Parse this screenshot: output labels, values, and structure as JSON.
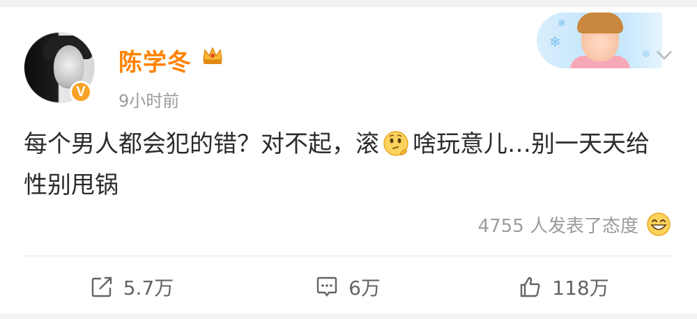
{
  "post": {
    "username": "陈学冬",
    "time": "9小时前",
    "text_before_emoji": "每个男人都会犯的错？对不起，滚",
    "text_after_emoji": "啥玩意儿…别一天天给性别甩锅",
    "inline_emoji": "thinking-face-icon",
    "verified_badge": "V",
    "reactions_text": "4755 人发表了态度",
    "reactions_emoji": "grinning-face-icon"
  },
  "actions": {
    "repost_count": "5.7万",
    "comment_count": "6万",
    "like_count": "118万"
  },
  "colors": {
    "username": "#ff8200",
    "verified": "#f8a327",
    "muted": "#9b9b9b",
    "text": "#2b2b2b"
  }
}
